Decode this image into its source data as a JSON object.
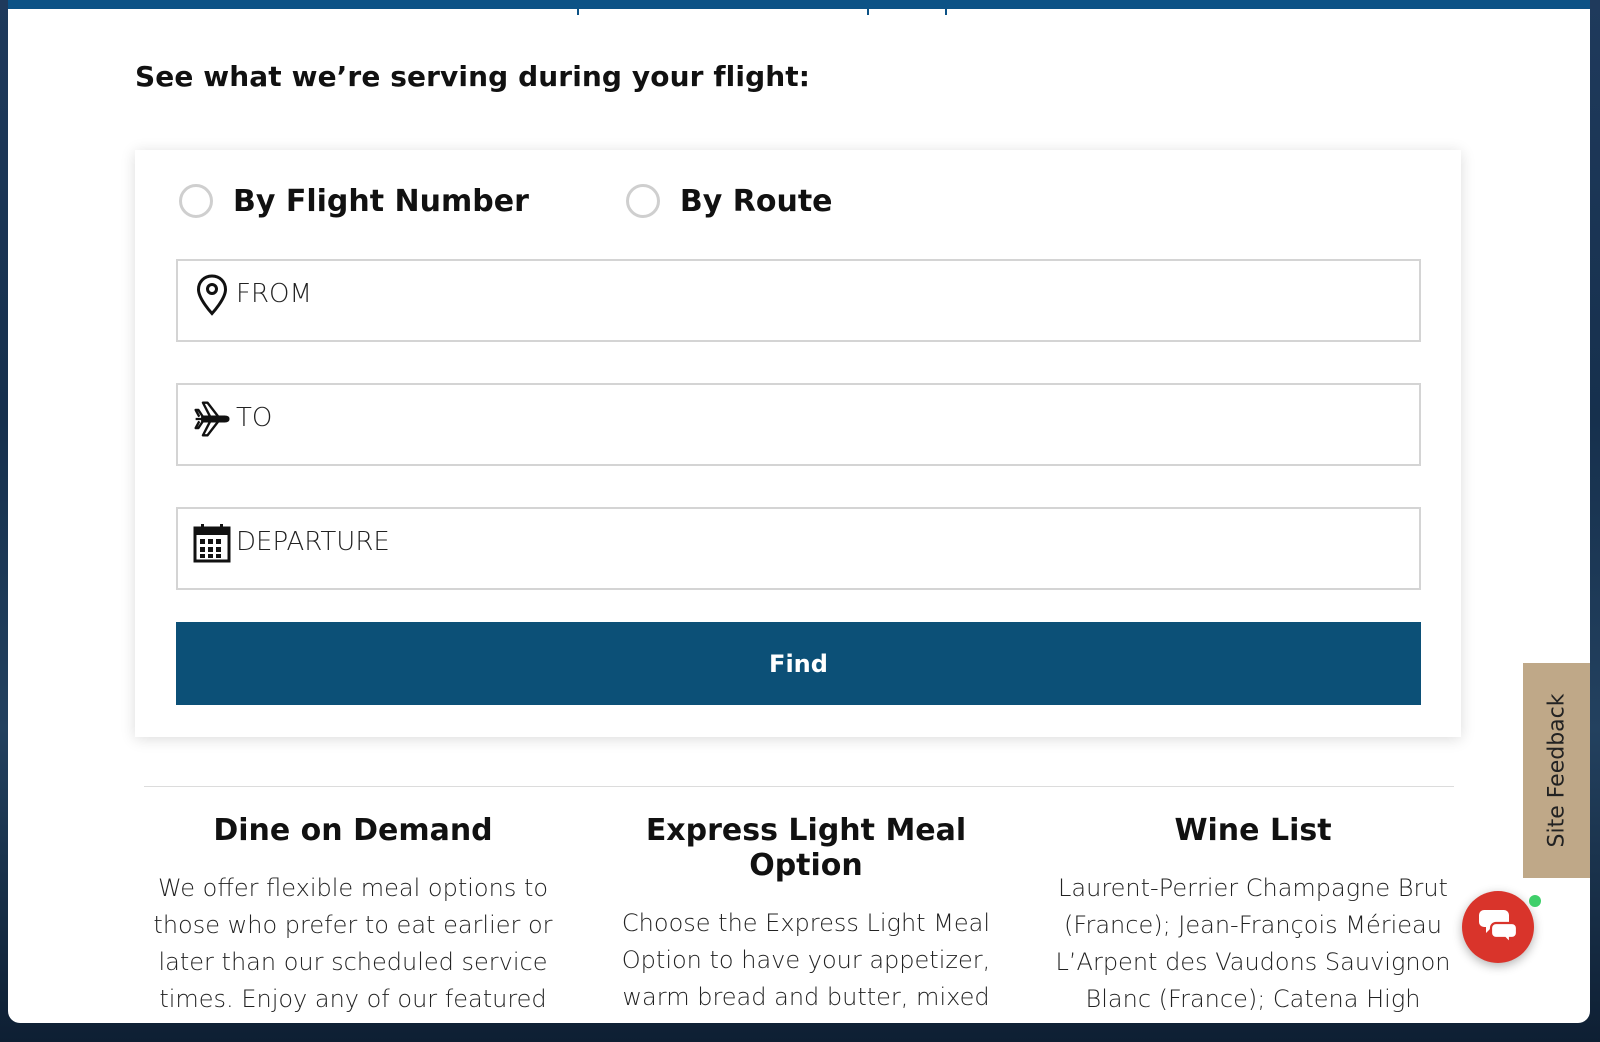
{
  "colors": {
    "brand_blue": "#0c5077",
    "top_band": "#0c5286",
    "feedback_tab": "#bfa888",
    "chat_red": "#d9342b",
    "status_green": "#3fcf6a"
  },
  "page": {
    "section_title": "See what we’re serving during your flight:"
  },
  "search": {
    "radio_options": [
      {
        "label": "By Flight Number",
        "selected": false
      },
      {
        "label": "By Route",
        "selected": false
      }
    ],
    "fields": [
      {
        "placeholder": "FROM",
        "icon": "map-pin-icon"
      },
      {
        "placeholder": "TO",
        "icon": "airplane-icon"
      },
      {
        "placeholder": "DEPARTURE",
        "icon": "calendar-icon"
      }
    ],
    "find_label": "Find"
  },
  "info_columns": [
    {
      "title": "Dine on Demand",
      "text": "We offer flexible meal options to those who prefer to eat earlier or later than our scheduled service times. Enjoy any of our featured main courses served with warm"
    },
    {
      "title": "Express Light Meal Option",
      "text": "Choose the Express Light Meal Option to have your appetizer, warm bread and butter, mixed greens, cheese and crackers, and fruit served shortly after"
    },
    {
      "title": "Wine List",
      "text": "Laurent-Perrier Champagne Brut (France); Jean-François Mérieau L’Arpent des Vaudons Sauvignon Blanc (France); Catena High Mountain Vines Chardonnay"
    }
  ],
  "widgets": {
    "feedback_label": "Site Feedback",
    "chat_icon": "chat-bubble-icon"
  }
}
